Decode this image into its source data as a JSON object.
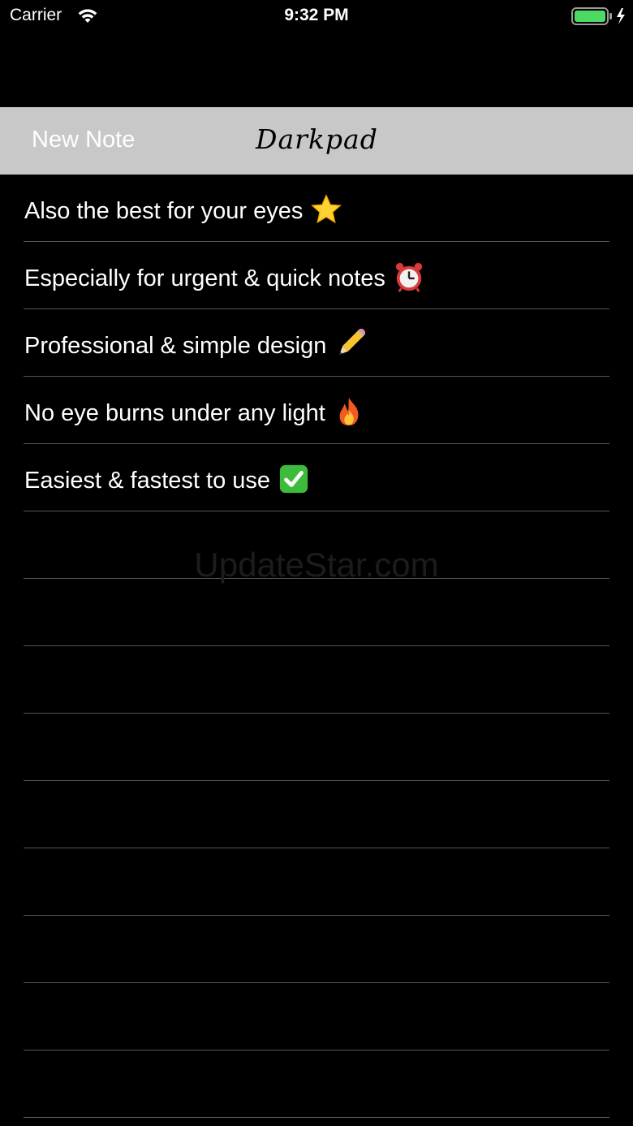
{
  "status_bar": {
    "carrier": "Carrier",
    "time": "9:32 PM",
    "wifi_icon": "wifi-icon",
    "battery_icon": "battery-charging-icon",
    "battery_level": 1.0,
    "battery_color": "#4cd964"
  },
  "nav": {
    "new_note_label": "New Note",
    "title": "Darkpad",
    "background": "#c8c8c8"
  },
  "notes": [
    {
      "text": "Also the best for your eyes",
      "icon": "star-icon"
    },
    {
      "text": "Especially for urgent & quick notes",
      "icon": "alarm-clock-icon"
    },
    {
      "text": "Professional & simple design",
      "icon": "pencil-icon"
    },
    {
      "text": "No eye burns under any light",
      "icon": "fire-icon"
    },
    {
      "text": "Easiest & fastest to use",
      "icon": "check-mark-button-icon"
    }
  ],
  "empty_row_count": 9,
  "watermark": "UpdateStar.com"
}
